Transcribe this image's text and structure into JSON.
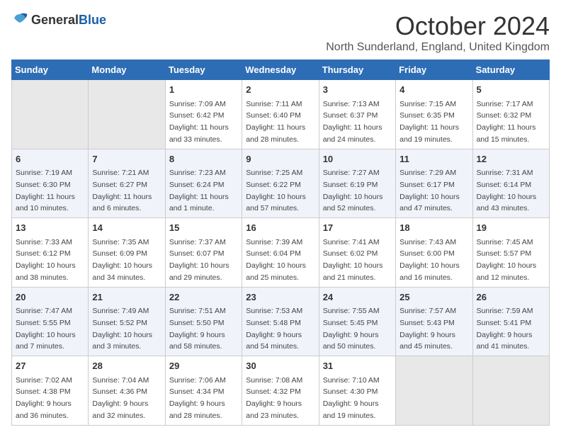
{
  "header": {
    "logo_general": "General",
    "logo_blue": "Blue",
    "month_title": "October 2024",
    "location": "North Sunderland, England, United Kingdom"
  },
  "weekdays": [
    "Sunday",
    "Monday",
    "Tuesday",
    "Wednesday",
    "Thursday",
    "Friday",
    "Saturday"
  ],
  "weeks": [
    [
      {
        "day": "",
        "sunrise": "",
        "sunset": "",
        "daylight": ""
      },
      {
        "day": "",
        "sunrise": "",
        "sunset": "",
        "daylight": ""
      },
      {
        "day": "1",
        "sunrise": "Sunrise: 7:09 AM",
        "sunset": "Sunset: 6:42 PM",
        "daylight": "Daylight: 11 hours and 33 minutes."
      },
      {
        "day": "2",
        "sunrise": "Sunrise: 7:11 AM",
        "sunset": "Sunset: 6:40 PM",
        "daylight": "Daylight: 11 hours and 28 minutes."
      },
      {
        "day": "3",
        "sunrise": "Sunrise: 7:13 AM",
        "sunset": "Sunset: 6:37 PM",
        "daylight": "Daylight: 11 hours and 24 minutes."
      },
      {
        "day": "4",
        "sunrise": "Sunrise: 7:15 AM",
        "sunset": "Sunset: 6:35 PM",
        "daylight": "Daylight: 11 hours and 19 minutes."
      },
      {
        "day": "5",
        "sunrise": "Sunrise: 7:17 AM",
        "sunset": "Sunset: 6:32 PM",
        "daylight": "Daylight: 11 hours and 15 minutes."
      }
    ],
    [
      {
        "day": "6",
        "sunrise": "Sunrise: 7:19 AM",
        "sunset": "Sunset: 6:30 PM",
        "daylight": "Daylight: 11 hours and 10 minutes."
      },
      {
        "day": "7",
        "sunrise": "Sunrise: 7:21 AM",
        "sunset": "Sunset: 6:27 PM",
        "daylight": "Daylight: 11 hours and 6 minutes."
      },
      {
        "day": "8",
        "sunrise": "Sunrise: 7:23 AM",
        "sunset": "Sunset: 6:24 PM",
        "daylight": "Daylight: 11 hours and 1 minute."
      },
      {
        "day": "9",
        "sunrise": "Sunrise: 7:25 AM",
        "sunset": "Sunset: 6:22 PM",
        "daylight": "Daylight: 10 hours and 57 minutes."
      },
      {
        "day": "10",
        "sunrise": "Sunrise: 7:27 AM",
        "sunset": "Sunset: 6:19 PM",
        "daylight": "Daylight: 10 hours and 52 minutes."
      },
      {
        "day": "11",
        "sunrise": "Sunrise: 7:29 AM",
        "sunset": "Sunset: 6:17 PM",
        "daylight": "Daylight: 10 hours and 47 minutes."
      },
      {
        "day": "12",
        "sunrise": "Sunrise: 7:31 AM",
        "sunset": "Sunset: 6:14 PM",
        "daylight": "Daylight: 10 hours and 43 minutes."
      }
    ],
    [
      {
        "day": "13",
        "sunrise": "Sunrise: 7:33 AM",
        "sunset": "Sunset: 6:12 PM",
        "daylight": "Daylight: 10 hours and 38 minutes."
      },
      {
        "day": "14",
        "sunrise": "Sunrise: 7:35 AM",
        "sunset": "Sunset: 6:09 PM",
        "daylight": "Daylight: 10 hours and 34 minutes."
      },
      {
        "day": "15",
        "sunrise": "Sunrise: 7:37 AM",
        "sunset": "Sunset: 6:07 PM",
        "daylight": "Daylight: 10 hours and 29 minutes."
      },
      {
        "day": "16",
        "sunrise": "Sunrise: 7:39 AM",
        "sunset": "Sunset: 6:04 PM",
        "daylight": "Daylight: 10 hours and 25 minutes."
      },
      {
        "day": "17",
        "sunrise": "Sunrise: 7:41 AM",
        "sunset": "Sunset: 6:02 PM",
        "daylight": "Daylight: 10 hours and 21 minutes."
      },
      {
        "day": "18",
        "sunrise": "Sunrise: 7:43 AM",
        "sunset": "Sunset: 6:00 PM",
        "daylight": "Daylight: 10 hours and 16 minutes."
      },
      {
        "day": "19",
        "sunrise": "Sunrise: 7:45 AM",
        "sunset": "Sunset: 5:57 PM",
        "daylight": "Daylight: 10 hours and 12 minutes."
      }
    ],
    [
      {
        "day": "20",
        "sunrise": "Sunrise: 7:47 AM",
        "sunset": "Sunset: 5:55 PM",
        "daylight": "Daylight: 10 hours and 7 minutes."
      },
      {
        "day": "21",
        "sunrise": "Sunrise: 7:49 AM",
        "sunset": "Sunset: 5:52 PM",
        "daylight": "Daylight: 10 hours and 3 minutes."
      },
      {
        "day": "22",
        "sunrise": "Sunrise: 7:51 AM",
        "sunset": "Sunset: 5:50 PM",
        "daylight": "Daylight: 9 hours and 58 minutes."
      },
      {
        "day": "23",
        "sunrise": "Sunrise: 7:53 AM",
        "sunset": "Sunset: 5:48 PM",
        "daylight": "Daylight: 9 hours and 54 minutes."
      },
      {
        "day": "24",
        "sunrise": "Sunrise: 7:55 AM",
        "sunset": "Sunset: 5:45 PM",
        "daylight": "Daylight: 9 hours and 50 minutes."
      },
      {
        "day": "25",
        "sunrise": "Sunrise: 7:57 AM",
        "sunset": "Sunset: 5:43 PM",
        "daylight": "Daylight: 9 hours and 45 minutes."
      },
      {
        "day": "26",
        "sunrise": "Sunrise: 7:59 AM",
        "sunset": "Sunset: 5:41 PM",
        "daylight": "Daylight: 9 hours and 41 minutes."
      }
    ],
    [
      {
        "day": "27",
        "sunrise": "Sunrise: 7:02 AM",
        "sunset": "Sunset: 4:38 PM",
        "daylight": "Daylight: 9 hours and 36 minutes."
      },
      {
        "day": "28",
        "sunrise": "Sunrise: 7:04 AM",
        "sunset": "Sunset: 4:36 PM",
        "daylight": "Daylight: 9 hours and 32 minutes."
      },
      {
        "day": "29",
        "sunrise": "Sunrise: 7:06 AM",
        "sunset": "Sunset: 4:34 PM",
        "daylight": "Daylight: 9 hours and 28 minutes."
      },
      {
        "day": "30",
        "sunrise": "Sunrise: 7:08 AM",
        "sunset": "Sunset: 4:32 PM",
        "daylight": "Daylight: 9 hours and 23 minutes."
      },
      {
        "day": "31",
        "sunrise": "Sunrise: 7:10 AM",
        "sunset": "Sunset: 4:30 PM",
        "daylight": "Daylight: 9 hours and 19 minutes."
      },
      {
        "day": "",
        "sunrise": "",
        "sunset": "",
        "daylight": ""
      },
      {
        "day": "",
        "sunrise": "",
        "sunset": "",
        "daylight": ""
      }
    ]
  ]
}
